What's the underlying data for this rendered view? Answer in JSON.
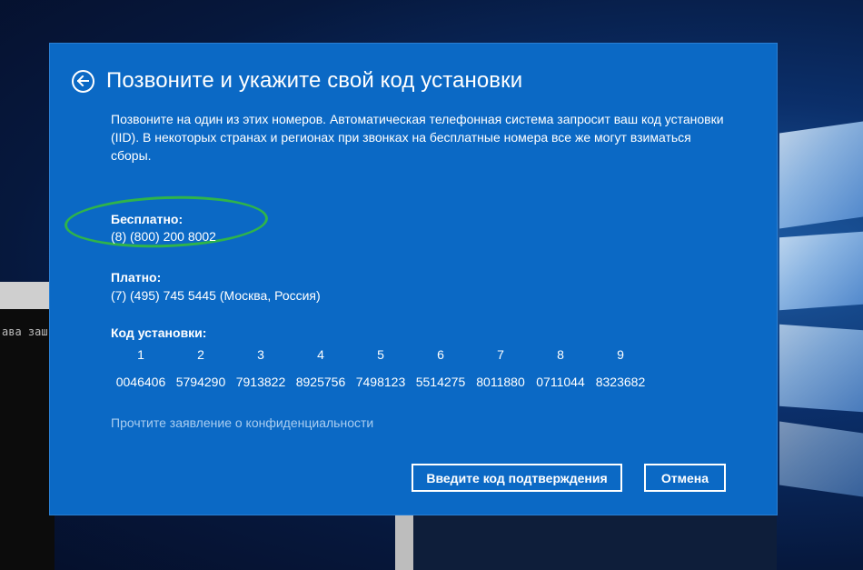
{
  "background": {
    "terminal_text": "ава заш"
  },
  "dialog": {
    "title": "Позвоните и укажите свой код установки",
    "description": "Позвоните на один из этих номеров. Автоматическая телефонная система запросит ваш код установки (IID). В некоторых странах и регионах при звонках на бесплатные номера все же могут взиматься сборы.",
    "free": {
      "label": "Бесплатно:",
      "number": "(8) (800) 200 8002"
    },
    "paid": {
      "label": "Платно:",
      "number": "(7) (495) 745 5445 (Москва, Россия)"
    },
    "installation_id": {
      "label": "Код установки:",
      "columns": [
        "1",
        "2",
        "3",
        "4",
        "5",
        "6",
        "7",
        "8",
        "9"
      ],
      "values": [
        "0046406",
        "5794290",
        "7913822",
        "8925756",
        "7498123",
        "5514275",
        "8011880",
        "0711044",
        "8323682"
      ]
    },
    "privacy_link": "Прочтите заявление о конфиденциальности",
    "buttons": {
      "confirm": "Введите код подтверждения",
      "cancel": "Отмена"
    }
  },
  "colors": {
    "dialog_bg": "#0b69c5",
    "highlight": "#2fb44a",
    "link": "#a9cdf0"
  }
}
